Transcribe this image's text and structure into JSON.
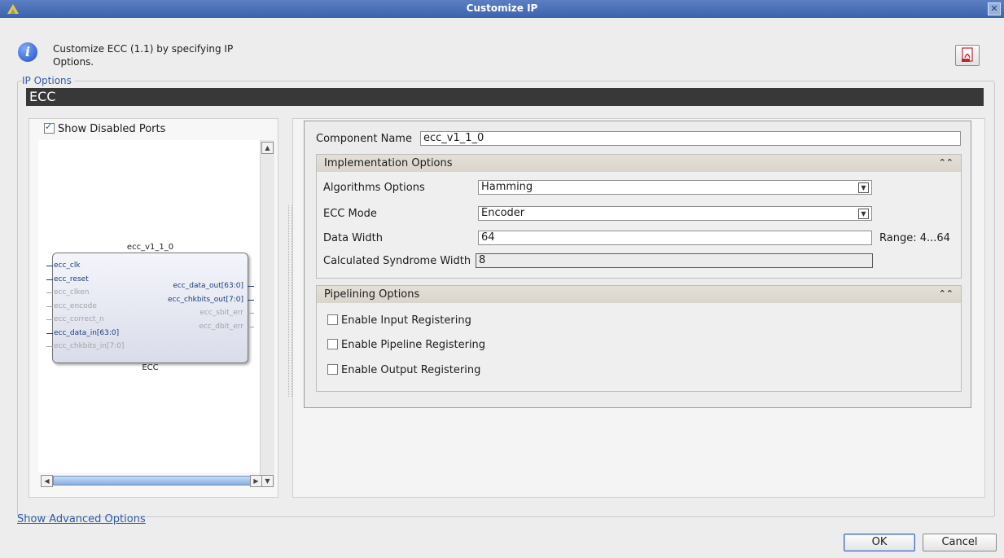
{
  "window": {
    "title": "Customize IP"
  },
  "info": {
    "text": "Customize ECC (1.1) by specifying IP Options."
  },
  "ip_options": {
    "legend": "IP Options",
    "header": "ECC"
  },
  "symbol": {
    "show_disabled_ports_label": "Show Disabled Ports",
    "show_disabled_ports_checked": true,
    "instance_name": "ecc_v1_1_0",
    "block_label": "ECC",
    "input_ports": [
      {
        "name": "ecc_clk",
        "enabled": true
      },
      {
        "name": "ecc_reset",
        "enabled": true
      },
      {
        "name": "ecc_clken",
        "enabled": false
      },
      {
        "name": "ecc_encode",
        "enabled": false
      },
      {
        "name": "ecc_correct_n",
        "enabled": false
      },
      {
        "name": "ecc_data_in[63:0]",
        "enabled": true
      },
      {
        "name": "ecc_chkbits_in[7:0]",
        "enabled": false
      }
    ],
    "output_ports": [
      {
        "name": "ecc_data_out[63:0]",
        "enabled": true
      },
      {
        "name": "ecc_chkbits_out[7:0]",
        "enabled": true
      },
      {
        "name": "ecc_sbit_err",
        "enabled": false
      },
      {
        "name": "ecc_dbit_err",
        "enabled": false
      }
    ]
  },
  "config": {
    "component_name_label": "Component Name",
    "component_name_value": "ecc_v1_1_0",
    "implementation": {
      "title": "Implementation Options",
      "algorithm_label": "Algorithms Options",
      "algorithm_value": "Hamming",
      "mode_label": "ECC Mode",
      "mode_value": "Encoder",
      "data_width_label": "Data Width",
      "data_width_value": "64",
      "data_width_range": "Range: 4...64",
      "syndrome_label": "Calculated Syndrome Width",
      "syndrome_value": "8"
    },
    "pipelining": {
      "title": "Pipelining Options",
      "options": [
        {
          "label": "Enable Input Registering",
          "checked": false
        },
        {
          "label": "Enable Pipeline Registering",
          "checked": false
        },
        {
          "label": "Enable Output Registering",
          "checked": false
        }
      ]
    }
  },
  "footer": {
    "advanced_link": "Show Advanced Options",
    "ok_label": "OK",
    "cancel_label": "Cancel"
  },
  "colors": {
    "title_bar": "#4a6fb8",
    "header_bar": "#383838",
    "link": "#3059a8",
    "active_port": "#1d3b78",
    "disabled_port": "#a4a4a4"
  }
}
